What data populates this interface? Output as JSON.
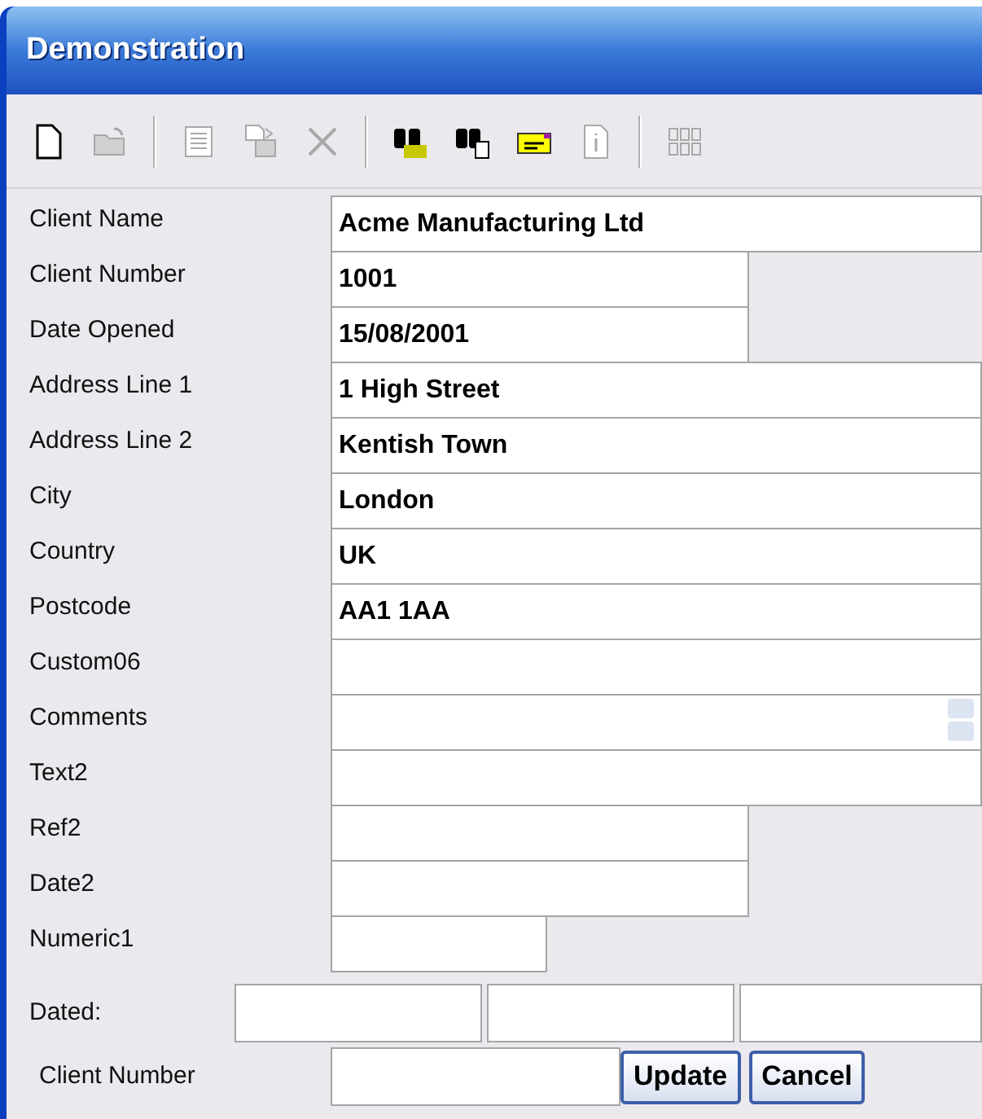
{
  "window": {
    "title": "Demonstration"
  },
  "toolbar": [
    {
      "kind": "new",
      "disabled": false
    },
    {
      "kind": "open",
      "disabled": true
    },
    {
      "kind": "separator"
    },
    {
      "kind": "list",
      "disabled": true
    },
    {
      "kind": "paste",
      "disabled": true
    },
    {
      "kind": "delete",
      "disabled": true
    },
    {
      "kind": "separator"
    },
    {
      "kind": "find",
      "disabled": false
    },
    {
      "kind": "find-document",
      "disabled": false
    },
    {
      "kind": "note",
      "disabled": false
    },
    {
      "kind": "info",
      "disabled": true
    },
    {
      "kind": "separator"
    },
    {
      "kind": "grid",
      "disabled": true
    }
  ],
  "fields": [
    {
      "label": "Client Name",
      "kind": "full",
      "value": "Acme Manufacturing Ltd"
    },
    {
      "label": "Client Number",
      "kind": "medium",
      "value": "1001"
    },
    {
      "label": "Date Opened",
      "kind": "medium",
      "value": "15/08/2001"
    },
    {
      "label": "Address Line 1",
      "kind": "full",
      "value": "1 High Street"
    },
    {
      "label": "Address Line 2",
      "kind": "full",
      "value": "Kentish Town"
    },
    {
      "label": "City",
      "kind": "full",
      "value": "London"
    },
    {
      "label": "Country",
      "kind": "full",
      "value": "UK"
    },
    {
      "label": "Postcode",
      "kind": "full",
      "value": "AA1 1AA"
    },
    {
      "label": "Custom06",
      "kind": "full"
    },
    {
      "label": "Comments",
      "kind": "memo"
    },
    {
      "label": "Text2",
      "kind": "full"
    },
    {
      "label": "Ref2",
      "kind": "medium"
    },
    {
      "label": "Date2",
      "kind": "medium"
    },
    {
      "label": "Numeric1",
      "kind": "short"
    }
  ],
  "dated": {
    "label": "Dated:"
  },
  "search": {
    "label": "Client Number"
  },
  "buttons": [
    "Update",
    "Cancel"
  ]
}
